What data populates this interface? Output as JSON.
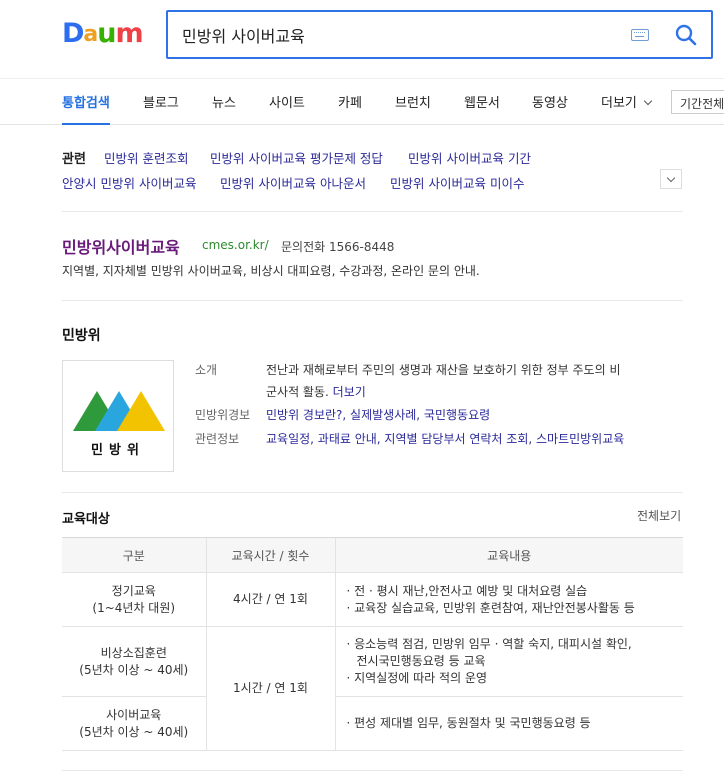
{
  "search": {
    "query": "민방위 사이버교육"
  },
  "tabs": {
    "items": [
      "통합검색",
      "블로그",
      "뉴스",
      "사이트",
      "카페",
      "브런치",
      "웹문서",
      "동영상",
      "더보기"
    ],
    "period": "기간전체"
  },
  "related": {
    "title": "관련",
    "links": [
      "민방위 훈련조회",
      "민방위 사이버교육 평가문제 정답",
      "민방위 사이버교육 기간",
      "안양시 민방위 사이버교육",
      "민방위 사이버교육 아나운서",
      "민방위 사이버교육 미이수"
    ]
  },
  "site": {
    "title": "민방위사이버교육",
    "url": "cmes.or.kr/",
    "phone": "문의전화 1566-8448",
    "desc": "지역별, 지자체별 민방위 사이버교육, 비상시 대피요령, 수강과정, 온라인 문의 안내."
  },
  "entity": {
    "title": "민방위",
    "logo_text": "민방위",
    "info": {
      "intro_label": "소개",
      "intro_line1": "전난과 재해로부터 주민의 생명과 재산을 보호하기 위한 정부 주도의 비",
      "intro_line2": "군사적 활동.",
      "intro_more": "더보기",
      "alert_label": "민방위경보",
      "alert_links": "민방위 경보란?, 실제발생사례, 국민행동요령",
      "related_label": "관련정보",
      "related_links": "교육일정, 과태료 안내, 지역별 담당부서 연락처 조회, 스마트민방위교육"
    }
  },
  "education": {
    "title": "교육대상",
    "more": "전체보기",
    "headers": [
      "구분",
      "교육시간 / 횟수",
      "교육내용"
    ],
    "rows": [
      {
        "type1": "정기교육",
        "type2": "(1~4년차 대원)",
        "time": "4시간 / 연 1회",
        "c1": "· 전 · 평시 재난,안전사고 예방 및 대처요령 실습",
        "c2": "· 교육장 실습교육, 민방위 훈련참여, 재난안전봉사활동 등"
      },
      {
        "type1": "비상소집훈련",
        "type2": "(5년차 이상 ~ 40세)",
        "time": "1시간 / 연 1회",
        "c1": "· 응소능력 점검, 민방위 임무 · 역할 숙지, 대피시설 확인,",
        "c2": "전시국민행동요령 등 교육",
        "c3": "· 지역실정에 따라 적의 운영"
      },
      {
        "type1": "사이버교육",
        "type2": "(5년차 이상 ~ 40세)",
        "c1": "· 편성 제대별 임무, 동원절차 및 국민행동요령 등"
      }
    ]
  }
}
